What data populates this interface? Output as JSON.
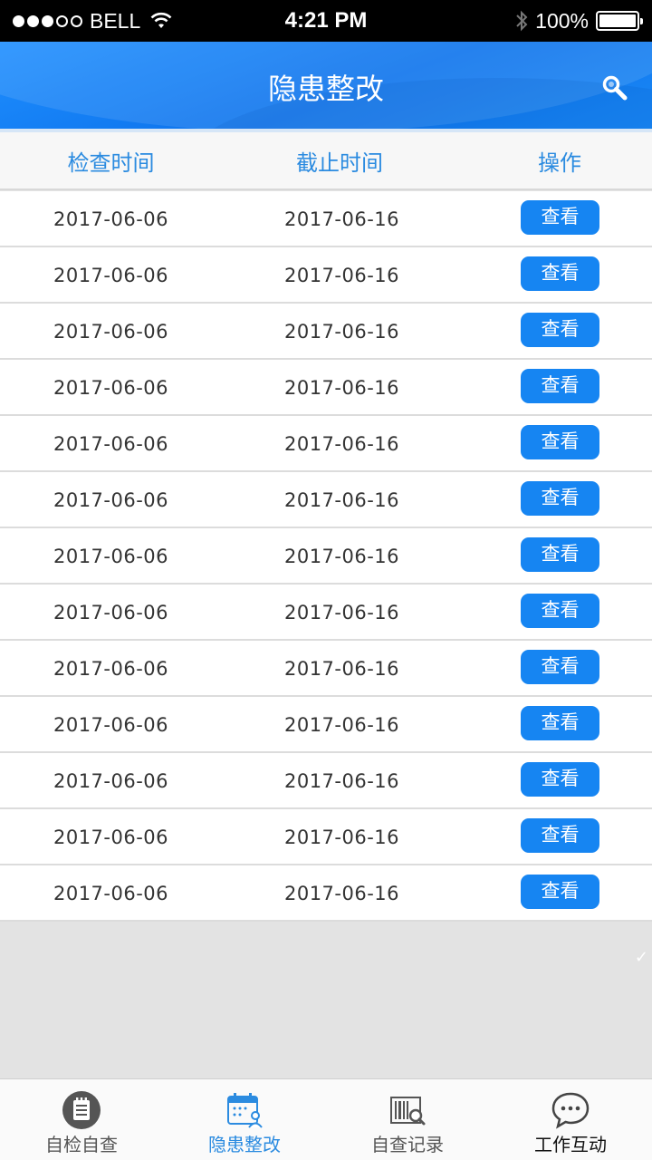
{
  "status_bar": {
    "carrier": "BELL",
    "time": "4:21 PM",
    "battery": "100%"
  },
  "header": {
    "title": "隐患整改",
    "search_icon": "search-icon"
  },
  "table": {
    "columns": [
      "检查时间",
      "截止时间",
      "操作"
    ],
    "rows": [
      {
        "check_time": "2017-06-06",
        "deadline": "2017-06-16",
        "action": "查看"
      },
      {
        "check_time": "2017-06-06",
        "deadline": "2017-06-16",
        "action": "查看"
      },
      {
        "check_time": "2017-06-06",
        "deadline": "2017-06-16",
        "action": "查看"
      },
      {
        "check_time": "2017-06-06",
        "deadline": "2017-06-16",
        "action": "查看"
      },
      {
        "check_time": "2017-06-06",
        "deadline": "2017-06-16",
        "action": "查看"
      },
      {
        "check_time": "2017-06-06",
        "deadline": "2017-06-16",
        "action": "查看"
      },
      {
        "check_time": "2017-06-06",
        "deadline": "2017-06-16",
        "action": "查看"
      },
      {
        "check_time": "2017-06-06",
        "deadline": "2017-06-16",
        "action": "查看"
      },
      {
        "check_time": "2017-06-06",
        "deadline": "2017-06-16",
        "action": "查看"
      },
      {
        "check_time": "2017-06-06",
        "deadline": "2017-06-16",
        "action": "查看"
      },
      {
        "check_time": "2017-06-06",
        "deadline": "2017-06-16",
        "action": "查看"
      },
      {
        "check_time": "2017-06-06",
        "deadline": "2017-06-16",
        "action": "查看"
      },
      {
        "check_time": "2017-06-06",
        "deadline": "2017-06-16",
        "action": "查看"
      }
    ]
  },
  "tab_bar": {
    "items": [
      {
        "label": "自检自查",
        "icon": "checklist-icon",
        "active": false
      },
      {
        "label": "隐患整改",
        "icon": "calendar-person-icon",
        "active": true
      },
      {
        "label": "自查记录",
        "icon": "barcode-search-icon",
        "active": false
      },
      {
        "label": "工作互动",
        "icon": "chat-bubble-icon",
        "active": false
      }
    ]
  },
  "colors": {
    "accent": "#1685f2",
    "header_blue": "#0d73ec",
    "active_tab": "#2b8be0"
  }
}
